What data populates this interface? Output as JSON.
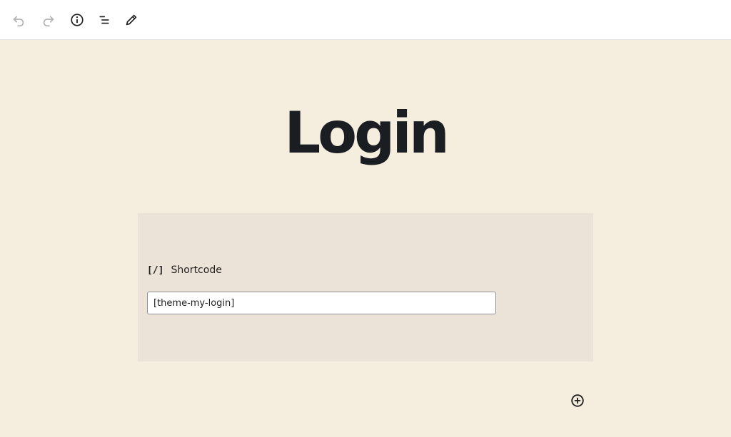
{
  "toolbar": {
    "undo_icon": "undo-icon",
    "redo_icon": "redo-icon",
    "info_icon": "info-icon",
    "outline_icon": "list-view-icon",
    "edit_icon": "pencil-icon"
  },
  "page": {
    "title": "Login"
  },
  "shortcode_block": {
    "label": "Shortcode",
    "icon_glyph": "[/]",
    "value": "[theme-my-login]"
  },
  "add_block_icon": "plus-circle-icon",
  "colors": {
    "canvas_bg": "#f5eedf",
    "block_bg": "#ebe3d7",
    "title": "#1a1d21"
  }
}
